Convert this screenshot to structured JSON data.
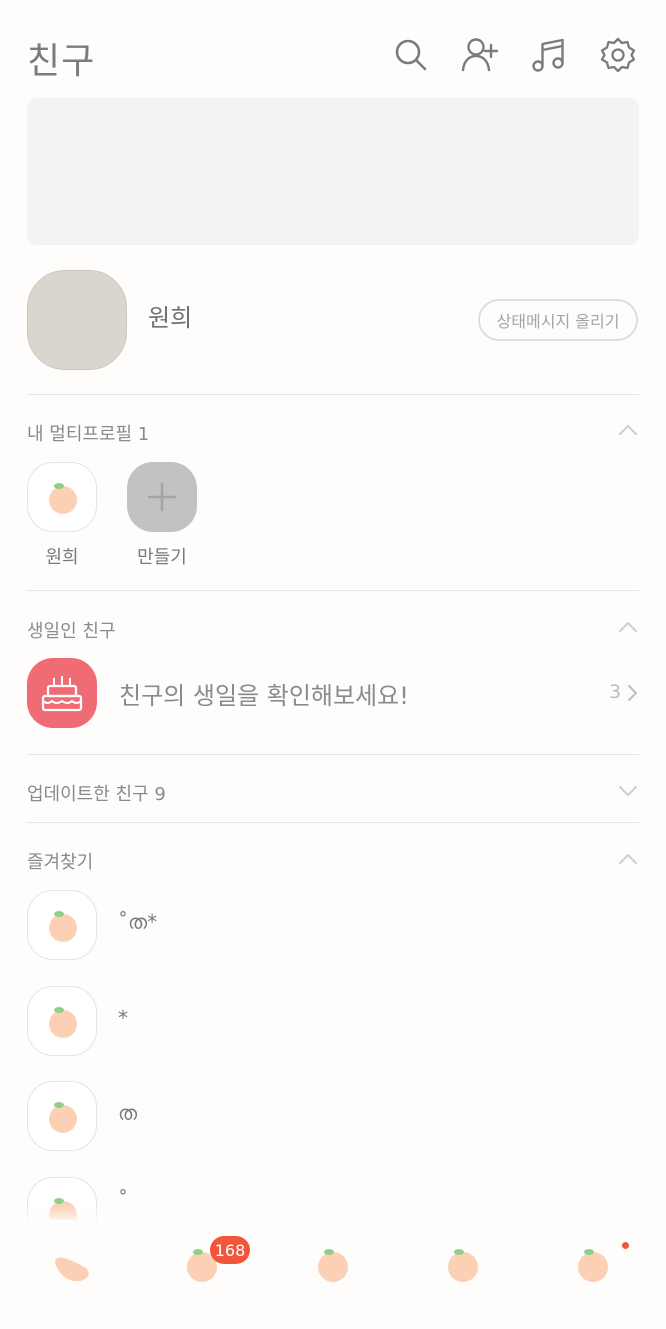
{
  "header": {
    "title": "친구",
    "icons": [
      "search-icon",
      "add-friend-icon",
      "music-icon",
      "settings-icon"
    ]
  },
  "profile": {
    "name": "원희",
    "status_button": "상태메시지 올리기"
  },
  "multi_profile": {
    "title": "내 멀티프로필 1",
    "items": [
      {
        "label": "원희",
        "icon": "peach-icon"
      },
      {
        "label": "만들기",
        "icon": "plus-icon"
      }
    ]
  },
  "birthday": {
    "title": "생일인 친구",
    "text": "친구의 생일을 확인해보세요!",
    "count": "3"
  },
  "updated": {
    "title": "업데이트한 친구 9"
  },
  "favorites": {
    "title": "즐겨찾기",
    "items": [
      {
        "name": "˚ത*"
      },
      {
        "name": "*"
      },
      {
        "name": "ത"
      },
      {
        "name": "˚"
      }
    ]
  },
  "tabbar": {
    "tabs": [
      "friends-tab",
      "chats-tab",
      "view-tab",
      "shopping-tab",
      "more-tab"
    ],
    "chat_badge": "168"
  },
  "colors": {
    "accent": "#f3553b",
    "peach": "#fbd0b4",
    "leaf": "#8fcf8a",
    "cake_bg": "#f06c75"
  }
}
